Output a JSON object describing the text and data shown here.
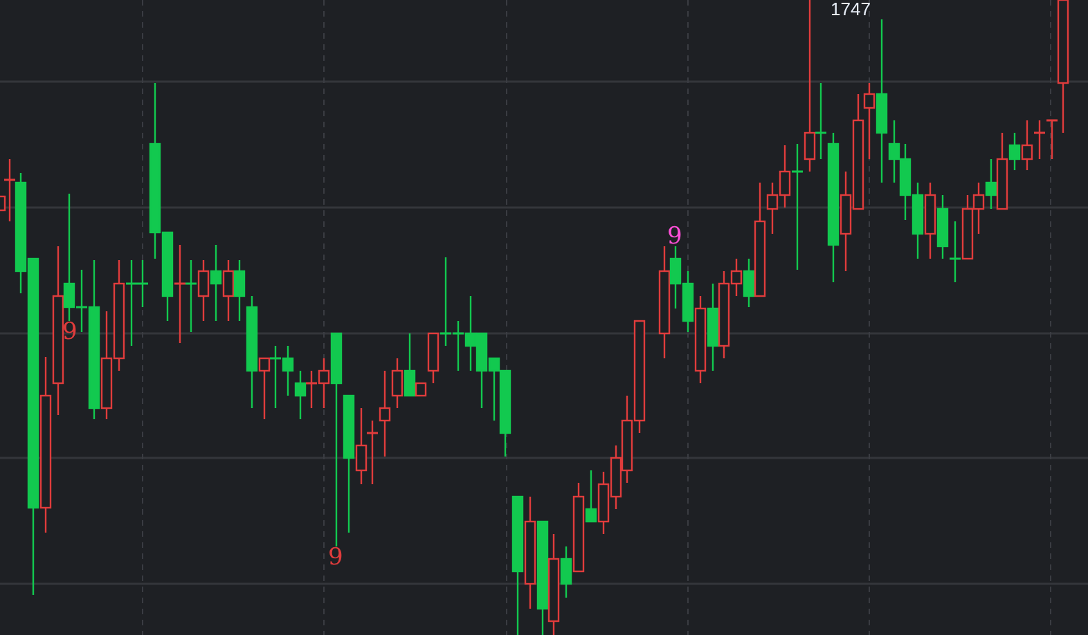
{
  "chart": {
    "price_label": "1747",
    "signals": [
      {
        "text": "9",
        "color": "#e03c3c"
      },
      {
        "text": "9",
        "color": "#e03c3c"
      },
      {
        "text": "9",
        "color": "#ff4fd8"
      }
    ]
  }
}
